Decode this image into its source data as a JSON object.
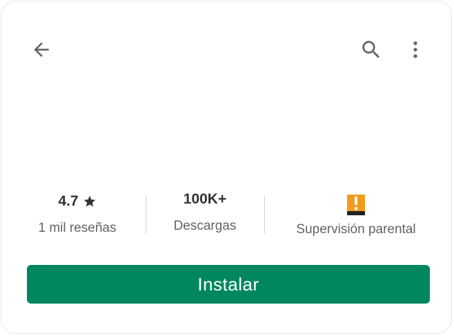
{
  "header": {
    "back_icon": "arrow-back-icon",
    "search_icon": "search-icon",
    "more_icon": "more-vertical-icon"
  },
  "stats": {
    "rating_value": "4.7",
    "rating_icon": "star-icon",
    "rating_label": "1 mil reseñas",
    "downloads_value": "100K+",
    "downloads_label": "Descargas",
    "parental_icon": "parental-supervision-icon",
    "parental_label": "Supervisión parental"
  },
  "install": {
    "label": "Instalar"
  },
  "colors": {
    "accent": "#01875f",
    "icon": "#666666",
    "badge": "#f29c1f"
  }
}
